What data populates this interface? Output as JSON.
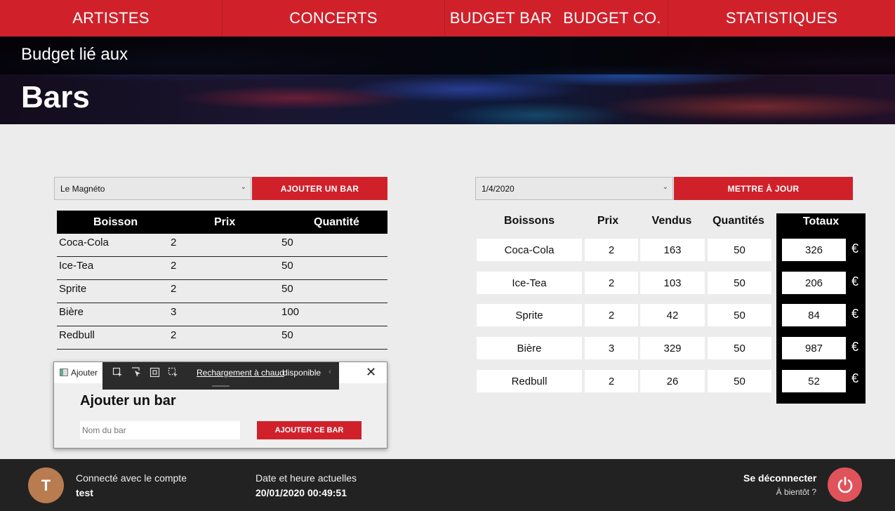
{
  "nav": {
    "items": [
      {
        "label": "ARTISTES"
      },
      {
        "label": "CONCERTS"
      },
      {
        "label": "BUDGET BAR"
      },
      {
        "label": "BUDGET CO."
      },
      {
        "label": "STATISTIQUES"
      }
    ]
  },
  "hero": {
    "subtitle": "Budget lié aux",
    "title": "Bars"
  },
  "left": {
    "bar_select_value": "Le Magnéto",
    "add_bar_label": "AJOUTER UN BAR",
    "columns": [
      "Boisson",
      "Prix",
      "Quantité"
    ],
    "rows": [
      [
        "Coca-Cola",
        "2",
        "50"
      ],
      [
        "Ice-Tea",
        "2",
        "50"
      ],
      [
        "Sprite",
        "2",
        "50"
      ],
      [
        "Bière",
        "3",
        "100"
      ],
      [
        "Redbull",
        "2",
        "50"
      ]
    ]
  },
  "right": {
    "date_select_value": "1/4/2020",
    "update_label": "METTRE À JOUR",
    "columns": [
      "Boissons",
      "Prix",
      "Vendus",
      "Quantités",
      "Totaux"
    ],
    "rows": [
      [
        "Coca-Cola",
        "2",
        "163",
        "50",
        "326"
      ],
      [
        "Ice-Tea",
        "2",
        "103",
        "50",
        "206"
      ],
      [
        "Sprite",
        "2",
        "42",
        "50",
        "84"
      ],
      [
        "Bière",
        "3",
        "329",
        "50",
        "987"
      ],
      [
        "Redbull",
        "2",
        "26",
        "50",
        "52"
      ]
    ],
    "currency": "€"
  },
  "dialog": {
    "app_title": "Ajouter",
    "hot_reload_link": "Rechargement à chaud",
    "hot_reload_status": "disponible",
    "heading": "Ajouter un bar",
    "name_placeholder": "Nom du bar",
    "submit_label": "AJOUTER CE BAR",
    "close_glyph": "✕"
  },
  "footer": {
    "avatar_initial": "T",
    "connected_label": "Connecté avec le compte",
    "username": "test",
    "datetime_label": "Date et heure actuelles",
    "datetime_value": "20/01/2020 00:49:51",
    "logout_label": "Se déconnecter",
    "bye_label": "À bientôt ?"
  },
  "colors": {
    "accent": "#d0212b",
    "footer_bg": "#222222",
    "power_button": "#e0535a",
    "avatar": "#b97b50"
  },
  "icons": [
    "chevron-down-icon",
    "select-element-icon",
    "display-layout-icon",
    "track-focus-icon",
    "close-icon",
    "power-icon",
    "app-window-icon"
  ]
}
